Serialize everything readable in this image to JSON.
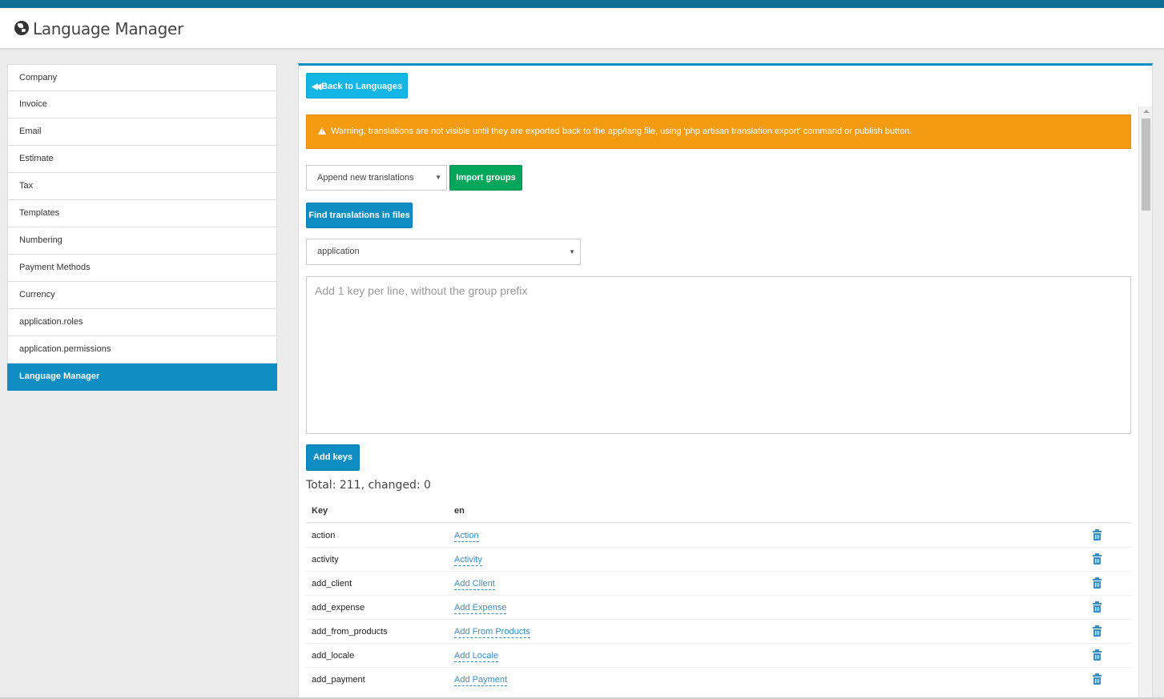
{
  "header": {
    "title": "Language Manager",
    "icon": "globe-icon"
  },
  "sidebar": {
    "items": [
      {
        "label": "Company"
      },
      {
        "label": "Invoice"
      },
      {
        "label": "Email"
      },
      {
        "label": "Estimate"
      },
      {
        "label": "Tax"
      },
      {
        "label": "Templates"
      },
      {
        "label": "Numbering"
      },
      {
        "label": "Payment Methods"
      },
      {
        "label": "Currency"
      },
      {
        "label": "application.roles"
      },
      {
        "label": "application.permissions"
      },
      {
        "label": "Language Manager",
        "active": true
      }
    ]
  },
  "main": {
    "back_button": "Back to Languages",
    "warning": "Warning, translations are not visible until they are exported back to the app/lang file, using 'php artisan translation:export' command or publish button.",
    "import_mode": {
      "selected": "Append new translations"
    },
    "import_button": "Import groups",
    "find_button": "Find translations in files",
    "group_select": {
      "selected": "application"
    },
    "keys_placeholder": "Add 1 key per line, without the group prefix",
    "add_keys_button": "Add keys",
    "total_text": "Total: 211, changed: 0",
    "table": {
      "headers": {
        "key": "Key",
        "locale": "en"
      },
      "rows": [
        {
          "key": "action",
          "value": "Action"
        },
        {
          "key": "activity",
          "value": "Activity"
        },
        {
          "key": "add_client",
          "value": "Add Client"
        },
        {
          "key": "add_expense",
          "value": "Add Expense"
        },
        {
          "key": "add_from_products",
          "value": "Add From Products"
        },
        {
          "key": "add_locale",
          "value": "Add Locale"
        },
        {
          "key": "add_payment",
          "value": "Add Payment"
        }
      ]
    }
  },
  "colors": {
    "top_bar": "#0e6f93",
    "active_sidebar": "#0e8ec2",
    "back_button": "#13b6e5",
    "warning": "#f39c12",
    "import_button": "#00a65a",
    "primary_button": "#0e8ec2",
    "link": "#3c8dbc"
  }
}
